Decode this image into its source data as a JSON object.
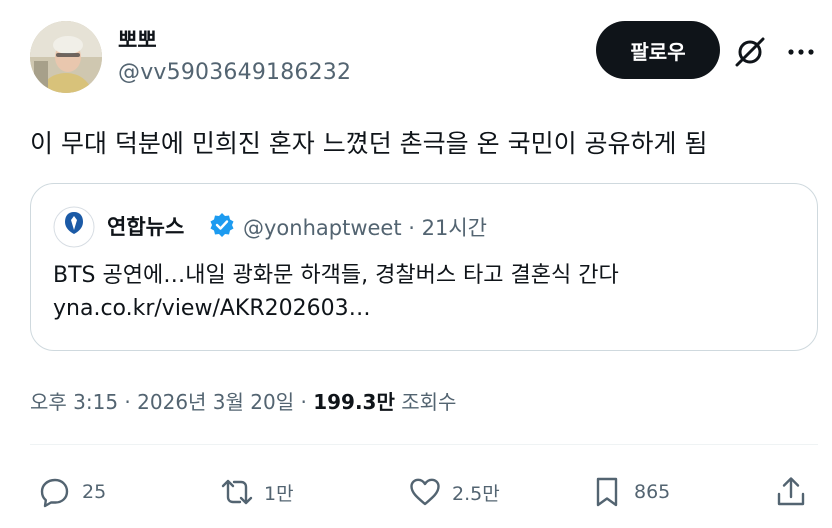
{
  "author": {
    "display_name": "뽀뽀",
    "handle": "@vv5903649186232"
  },
  "header": {
    "follow_label": "팔로우"
  },
  "tweet": {
    "text": "이 무대 덕분에 민희진 혼자 느꼈던 촌극을 온 국민이 공유하게 됨"
  },
  "quote": {
    "name": "연합뉴스",
    "meta": "@yonhaptweet · 21시간",
    "logo_text": "연합뉴스",
    "text": "BTS 공연에…내일 광화문 하객들, 경찰버스 타고 결혼식 간다",
    "link": "yna.co.kr/view/AKR202603…"
  },
  "timestamp": {
    "prefix": "오후 3:15 · 2026년 3월 20일 · ",
    "views": "199.3만",
    "views_label": " 조회수"
  },
  "actions": {
    "replies": "25",
    "reposts": "1만",
    "likes": "2.5만",
    "bookmarks": "865"
  },
  "colors": {
    "text_primary": "#0f1419",
    "text_secondary": "#536471",
    "border": "#cfd9de",
    "verified": "#1d9bf0"
  }
}
